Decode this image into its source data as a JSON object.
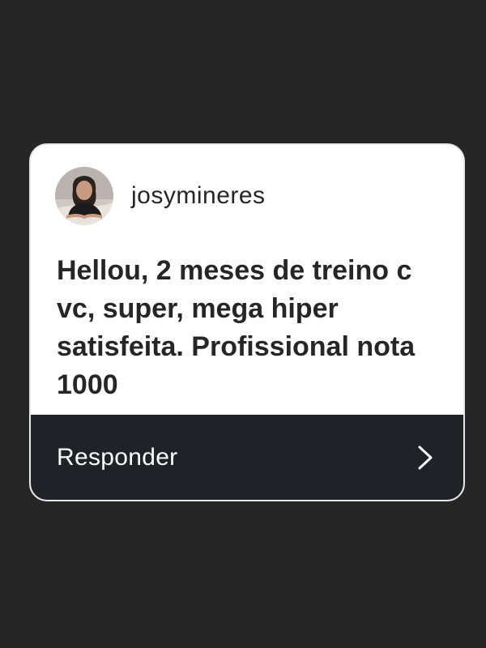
{
  "story_reply_card": {
    "username": "josymineres",
    "message": "Hellou, 2 meses de treino c vc, super, mega hiper satisfeita. Profissional nota 1000",
    "reply_label": "Responder",
    "avatar_icon": "profile-photo",
    "reply_icon": "chevron-right-icon"
  },
  "colors": {
    "background": "#262626",
    "card": "#ffffff",
    "reply_bar": "#1f2226",
    "text_dark": "#262626",
    "text_light": "#ffffff"
  }
}
